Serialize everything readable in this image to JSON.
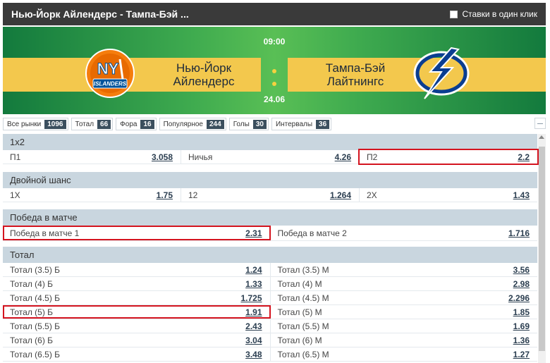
{
  "header": {
    "title": "Нью-Йорк Айлендерс - Тампа-Бэй ...",
    "one_click_label": "Ставки в один клик"
  },
  "match": {
    "time": "09:00",
    "date": "24.06",
    "team1": {
      "line1": "Нью-Йорк",
      "line2": "Айлендерс"
    },
    "team2": {
      "line1": "Тампа-Бэй",
      "line2": "Лайтнингс"
    },
    "logo1_text": {
      "top": "NY",
      "bottom": "ISLANDERS"
    }
  },
  "colors": {
    "accent_dark": "#3b4f5e",
    "section_head": "#c9d6df",
    "highlight": "#d4141f",
    "banner_green": "#3fab4f",
    "banner_yellow": "#f3c84d"
  },
  "filters": [
    {
      "label": "Все рынки",
      "count": "1096"
    },
    {
      "label": "Тотал",
      "count": "66"
    },
    {
      "label": "Фора",
      "count": "16"
    },
    {
      "label": "Популярное",
      "count": "244"
    },
    {
      "label": "Голы",
      "count": "30"
    },
    {
      "label": "Интервалы",
      "count": "36"
    }
  ],
  "sections": {
    "s1x2": {
      "title": "1x2",
      "cells": [
        {
          "label": "П1",
          "odd": "3.058"
        },
        {
          "label": "Ничья",
          "odd": "4.26"
        },
        {
          "label": "П2",
          "odd": "2.2"
        }
      ]
    },
    "double": {
      "title": "Двойной шанс",
      "cells": [
        {
          "label": "1X",
          "odd": "1.75"
        },
        {
          "label": "12",
          "odd": "1.264"
        },
        {
          "label": "2X",
          "odd": "1.43"
        }
      ]
    },
    "win": {
      "title": "Победа в матче",
      "cells": [
        {
          "label": "Победа в матче 1",
          "odd": "2.31"
        },
        {
          "label": "Победа в матче 2",
          "odd": "1.716"
        }
      ]
    },
    "total": {
      "title": "Тотал",
      "rows": [
        [
          {
            "label": "Тотал (3.5) Б",
            "odd": "1.24"
          },
          {
            "label": "Тотал (3.5) М",
            "odd": "3.56"
          }
        ],
        [
          {
            "label": "Тотал (4) Б",
            "odd": "1.33"
          },
          {
            "label": "Тотал (4) М",
            "odd": "2.98"
          }
        ],
        [
          {
            "label": "Тотал (4.5) Б",
            "odd": "1.725"
          },
          {
            "label": "Тотал (4.5) М",
            "odd": "2.296"
          }
        ],
        [
          {
            "label": "Тотал (5) Б",
            "odd": "1.91"
          },
          {
            "label": "Тотал (5) М",
            "odd": "1.85"
          }
        ],
        [
          {
            "label": "Тотал (5.5) Б",
            "odd": "2.43"
          },
          {
            "label": "Тотал (5.5) М",
            "odd": "1.69"
          }
        ],
        [
          {
            "label": "Тотал (6) Б",
            "odd": "3.04"
          },
          {
            "label": "Тотал (6) М",
            "odd": "1.36"
          }
        ],
        [
          {
            "label": "Тотал (6.5) Б",
            "odd": "3.48"
          },
          {
            "label": "Тотал (6.5) М",
            "odd": "1.27"
          }
        ]
      ]
    }
  }
}
